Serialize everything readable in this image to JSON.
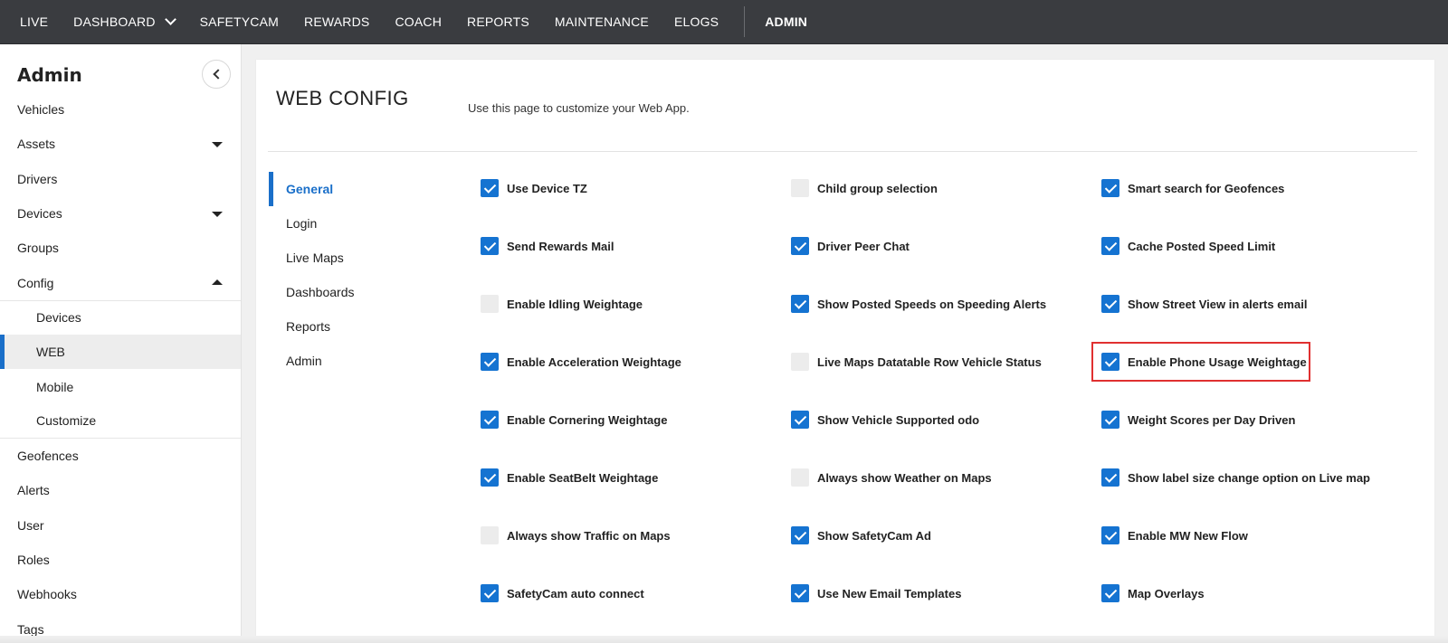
{
  "topnav": {
    "items": [
      {
        "label": "LIVE"
      },
      {
        "label": "DASHBOARD"
      },
      {
        "label": "SAFETYCAM"
      },
      {
        "label": "REWARDS"
      },
      {
        "label": "COACH"
      },
      {
        "label": "REPORTS"
      },
      {
        "label": "MAINTENANCE"
      },
      {
        "label": "ELOGS"
      },
      {
        "label": "ADMIN"
      }
    ]
  },
  "sidebar": {
    "title": "Admin",
    "items": [
      {
        "label": "Vehicles"
      },
      {
        "label": "Assets"
      },
      {
        "label": "Drivers"
      },
      {
        "label": "Devices"
      },
      {
        "label": "Groups"
      },
      {
        "label": "Config"
      },
      {
        "label": "Devices"
      },
      {
        "label": "WEB"
      },
      {
        "label": "Mobile"
      },
      {
        "label": "Customize"
      },
      {
        "label": "Geofences"
      },
      {
        "label": "Alerts"
      },
      {
        "label": "User"
      },
      {
        "label": "Roles"
      },
      {
        "label": "Webhooks"
      },
      {
        "label": "Tags"
      }
    ]
  },
  "main": {
    "title": "WEB CONFIG",
    "description": "Use this page to customize your Web App.",
    "tabs": [
      {
        "label": "General"
      },
      {
        "label": "Login"
      },
      {
        "label": "Live Maps"
      },
      {
        "label": "Dashboards"
      },
      {
        "label": "Reports"
      },
      {
        "label": "Admin"
      }
    ],
    "options": [
      {
        "label": "Use Device TZ",
        "checked": true
      },
      {
        "label": "Child group selection",
        "checked": false
      },
      {
        "label": "Smart search for Geofences",
        "checked": true
      },
      {
        "label": "Send Rewards Mail",
        "checked": true
      },
      {
        "label": "Driver Peer Chat",
        "checked": true
      },
      {
        "label": "Cache Posted Speed Limit",
        "checked": true
      },
      {
        "label": "Enable Idling Weightage",
        "checked": false
      },
      {
        "label": "Show Posted Speeds on Speeding Alerts",
        "checked": true
      },
      {
        "label": "Show Street View in alerts email",
        "checked": true
      },
      {
        "label": "Enable Acceleration Weightage",
        "checked": true
      },
      {
        "label": "Live Maps Datatable Row Vehicle Status",
        "checked": false
      },
      {
        "label": "Enable Phone Usage Weightage",
        "checked": true
      },
      {
        "label": "Enable Cornering Weightage",
        "checked": true
      },
      {
        "label": "Show Vehicle Supported odo",
        "checked": true
      },
      {
        "label": "Weight Scores per Day Driven",
        "checked": true
      },
      {
        "label": "Enable SeatBelt Weightage",
        "checked": true
      },
      {
        "label": "Always show Weather on Maps",
        "checked": false
      },
      {
        "label": "Show label size change option on Live map",
        "checked": true
      },
      {
        "label": "Always show Traffic on Maps",
        "checked": false
      },
      {
        "label": "Show SafetyCam Ad",
        "checked": true
      },
      {
        "label": "Enable MW New Flow",
        "checked": true
      },
      {
        "label": "SafetyCam auto connect",
        "checked": true
      },
      {
        "label": "Use New Email Templates",
        "checked": true
      },
      {
        "label": "Map Overlays",
        "checked": true
      }
    ]
  },
  "colors": {
    "topnav_bg": "#3a3c40",
    "accent": "#1573d1",
    "highlight": "#e03030"
  }
}
